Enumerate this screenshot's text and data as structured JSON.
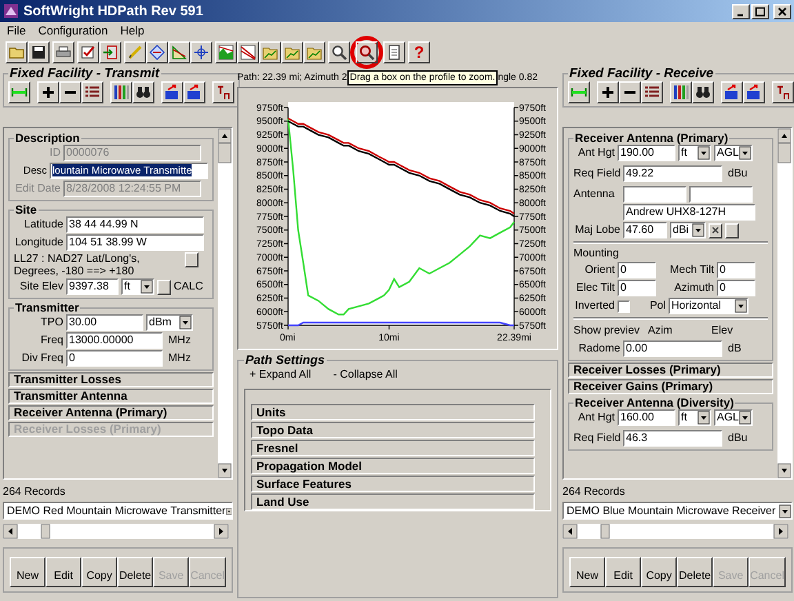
{
  "window": {
    "title": "SoftWright HDPath Rev 591"
  },
  "menu": [
    {
      "label": "File"
    },
    {
      "label": "Configuration"
    },
    {
      "label": "Help"
    }
  ],
  "toolbar": {
    "help_glyph": "?"
  },
  "transmit": {
    "title": "Fixed Facility - Transmit",
    "description": {
      "title": "Description",
      "id": {
        "label": "ID",
        "value": "0000076",
        "disabled": true
      },
      "desc": {
        "label": "Desc",
        "value": "lountain Microwave Transmitte",
        "selected": true
      },
      "edit_date": {
        "label": "Edit Date",
        "value": "8/28/2008 12:24:55 PM",
        "disabled": true
      }
    },
    "site": {
      "title": "Site",
      "latitude": {
        "label": "Latitude",
        "value": "38 44 44.99 N"
      },
      "longitude": {
        "label": "Longitude",
        "value": "104 51 38.99 W"
      },
      "note": "LL27 : NAD27 Lat/Long's, Degrees, -180 ==> +180",
      "site_elev": {
        "label": "Site Elev",
        "value": "9397.38",
        "unit": "ft",
        "calc": "CALC"
      }
    },
    "transmitter": {
      "title": "Transmitter",
      "tpo": {
        "label": "TPO",
        "value": "30.00",
        "unit": "dBm"
      },
      "freq": {
        "label": "Freq",
        "value": "13000.00000",
        "unit": "MHz"
      },
      "div_freq": {
        "label": "Div Freq",
        "value": "0",
        "unit": "MHz"
      }
    },
    "sections": [
      {
        "label": "Transmitter Losses",
        "disabled": false
      },
      {
        "label": "Transmitter Antenna",
        "disabled": false
      },
      {
        "label": "Receiver Antenna (Primary)",
        "disabled": false
      },
      {
        "label": "Receiver Losses (Primary)",
        "disabled": true
      }
    ],
    "records": "264 Records",
    "record_select": "DEMO Red Mountain Microwave Transmitter",
    "buttons": [
      {
        "label": "New",
        "disabled": false
      },
      {
        "label": "Edit",
        "disabled": false
      },
      {
        "label": "Copy",
        "disabled": false
      },
      {
        "label": "Delete",
        "disabled": false
      },
      {
        "label": "Save",
        "disabled": true
      },
      {
        "label": "Cancel",
        "disabled": true
      }
    ]
  },
  "path": {
    "summary_start": "Path: 22.39 mi; Azimuth 2",
    "tooltip": "Drag a box on the profile to zoom.",
    "summary_end": "ngle 0.82",
    "chart_data": {
      "type": "line",
      "x": [
        0,
        0.5,
        1,
        1.5,
        2,
        3,
        4,
        5,
        5.5,
        6,
        7,
        8,
        9,
        9.5,
        10,
        10.5,
        11,
        12,
        13,
        14,
        15,
        16,
        17,
        18,
        19,
        20,
        21,
        22,
        22.39
      ],
      "series": [
        {
          "color": "#33dd33",
          "values": [
            9550,
            8600,
            7500,
            6900,
            6300,
            6200,
            6050,
            5950,
            5950,
            6050,
            6100,
            6150,
            6250,
            6300,
            6400,
            6600,
            6450,
            6550,
            6800,
            6700,
            6800,
            6900,
            7050,
            7200,
            7400,
            7350,
            7450,
            7550,
            7650
          ]
        },
        {
          "color": "#cc0000",
          "values": [
            9550,
            9500,
            9450,
            9450,
            9400,
            9300,
            9250,
            9150,
            9100,
            9100,
            9000,
            8950,
            8850,
            8800,
            8750,
            8750,
            8700,
            8600,
            8550,
            8450,
            8400,
            8300,
            8200,
            8150,
            8050,
            8000,
            7900,
            7850,
            7800
          ]
        },
        {
          "color": "#000000",
          "values": [
            9500,
            9450,
            9400,
            9400,
            9350,
            9250,
            9200,
            9100,
            9050,
            9050,
            8950,
            8900,
            8800,
            8750,
            8700,
            8700,
            8650,
            8550,
            8500,
            8400,
            8350,
            8250,
            8150,
            8100,
            8000,
            7950,
            7850,
            7800,
            7750
          ]
        },
        {
          "color": "#4444ff",
          "values": [
            5750,
            5750,
            5750,
            5800,
            5800,
            5800,
            5800,
            5800,
            5800,
            5800,
            5800,
            5800,
            5800,
            5800,
            5800,
            5800,
            5800,
            5800,
            5800,
            5800,
            5800,
            5800,
            5800,
            5800,
            5800,
            5800,
            5800,
            5750,
            5750
          ]
        }
      ],
      "xlim": [
        0,
        22.39
      ],
      "ylim": [
        5750,
        9750
      ],
      "xticks": [
        {
          "value": 0,
          "label": "0mi"
        },
        {
          "value": 10,
          "label": "10mi"
        },
        {
          "value": 22.39,
          "label": "22.39mi"
        }
      ],
      "yticks": [
        {
          "value": 5750,
          "label": "5750ft"
        },
        {
          "value": 6000,
          "label": "6000ft"
        },
        {
          "value": 6250,
          "label": "6250ft"
        },
        {
          "value": 6500,
          "label": "6500ft"
        },
        {
          "value": 6750,
          "label": "6750ft"
        },
        {
          "value": 7000,
          "label": "7000ft"
        },
        {
          "value": 7250,
          "label": "7250ft"
        },
        {
          "value": 7500,
          "label": "7500ft"
        },
        {
          "value": 7750,
          "label": "7750ft"
        },
        {
          "value": 8000,
          "label": "8000ft"
        },
        {
          "value": 8250,
          "label": "8250ft"
        },
        {
          "value": 8500,
          "label": "8500ft"
        },
        {
          "value": 8750,
          "label": "8750ft"
        },
        {
          "value": 9000,
          "label": "9000ft"
        },
        {
          "value": 9250,
          "label": "9250ft"
        },
        {
          "value": 9500,
          "label": "9500ft"
        },
        {
          "value": 9750,
          "label": "9750ft"
        }
      ]
    },
    "settings": {
      "title": "Path Settings",
      "expand": "+ Expand All",
      "collapse": "- Collapse All",
      "groups": [
        {
          "label": "Units"
        },
        {
          "label": "Topo Data"
        },
        {
          "label": "Fresnel"
        },
        {
          "label": "Propagation Model"
        },
        {
          "label": "Surface Features"
        },
        {
          "label": "Land Use"
        }
      ]
    }
  },
  "receive": {
    "title": "Fixed Facility - Receive",
    "antenna_primary": {
      "title": "Receiver Antenna (Primary)",
      "ant_hgt": {
        "label": "Ant Hgt",
        "value": "190.00",
        "unit": "ft",
        "reference": "AGL"
      },
      "req_field": {
        "label": "Req Field",
        "value": "49.22",
        "unit": "dBu"
      },
      "antenna": {
        "label": "Antenna",
        "model": "Andrew UHX8-127H"
      },
      "maj_lobe": {
        "label": "Maj Lobe",
        "value": "47.60",
        "unit": "dBi"
      },
      "mounting": {
        "label": "Mounting",
        "orient": {
          "label": "Orient",
          "value": "0"
        },
        "mech_tilt": {
          "label": "Mech Tilt",
          "value": "0"
        },
        "elec_tilt": {
          "label": "Elec Tilt",
          "value": "0"
        },
        "azimuth": {
          "label": "Azimuth",
          "value": "0"
        },
        "inverted": {
          "label": "Inverted",
          "checked": false
        },
        "pol": {
          "label": "Pol",
          "value": "Horizontal"
        }
      },
      "preview": {
        "label": "Show previev",
        "azim": "Azim",
        "elev": "Elev"
      },
      "radome": {
        "label": "Radome",
        "value": "0.00",
        "unit": "dB"
      }
    },
    "sections": [
      {
        "label": "Receiver Losses (Primary)",
        "disabled": false
      },
      {
        "label": "Receiver Gains (Primary)",
        "disabled": false
      }
    ],
    "antenna_diversity": {
      "title": "Receiver Antenna (Diversity)",
      "ant_hgt": {
        "label": "Ant Hgt",
        "value": "160.00",
        "unit": "ft",
        "reference": "AGL"
      },
      "req_field": {
        "label": "Req Field",
        "value": "46.3",
        "unit": "dBu"
      }
    },
    "records": "264 Records",
    "record_select": "DEMO Blue Mountain Microwave Receiver",
    "buttons": [
      {
        "label": "New",
        "disabled": false
      },
      {
        "label": "Edit",
        "disabled": false
      },
      {
        "label": "Copy",
        "disabled": false
      },
      {
        "label": "Delete",
        "disabled": false
      },
      {
        "label": "Save",
        "disabled": true
      },
      {
        "label": "Cancel",
        "disabled": true
      }
    ]
  }
}
